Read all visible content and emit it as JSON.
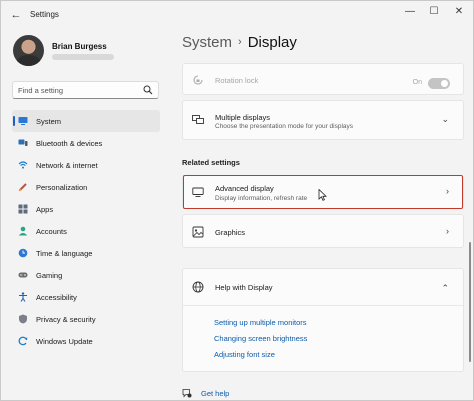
{
  "window": {
    "title": "Settings",
    "back_glyph": "←",
    "minimize_glyph": "—",
    "maximize_glyph": "☐",
    "close_glyph": "✕"
  },
  "profile": {
    "name": "Brian Burgess"
  },
  "search": {
    "placeholder": "Find a setting"
  },
  "sidebar": {
    "items": [
      {
        "label": "System",
        "icon": "system-icon",
        "active": true
      },
      {
        "label": "Bluetooth & devices",
        "icon": "bluetooth-icon"
      },
      {
        "label": "Network & internet",
        "icon": "network-icon"
      },
      {
        "label": "Personalization",
        "icon": "personalization-icon"
      },
      {
        "label": "Apps",
        "icon": "apps-icon"
      },
      {
        "label": "Accounts",
        "icon": "accounts-icon"
      },
      {
        "label": "Time & language",
        "icon": "time-language-icon"
      },
      {
        "label": "Gaming",
        "icon": "gaming-icon"
      },
      {
        "label": "Accessibility",
        "icon": "accessibility-icon"
      },
      {
        "label": "Privacy & security",
        "icon": "privacy-icon"
      },
      {
        "label": "Windows Update",
        "icon": "windows-update-icon"
      }
    ]
  },
  "breadcrumb": {
    "parent": "System",
    "separator": "›",
    "current": "Display"
  },
  "rotation_lock": {
    "title": "Rotation lock",
    "state_label": "On"
  },
  "multiple_displays": {
    "title": "Multiple displays",
    "subtitle": "Choose the presentation mode for your displays",
    "chevron": "⌄"
  },
  "related_settings": {
    "header": "Related settings",
    "advanced_display": {
      "title": "Advanced display",
      "subtitle": "Display information, refresh rate",
      "chevron": "›"
    },
    "graphics": {
      "title": "Graphics",
      "chevron": "›"
    }
  },
  "help": {
    "title": "Help with Display",
    "chevron": "⌃",
    "links": [
      "Setting up multiple monitors",
      "Changing screen brightness",
      "Adjusting font size"
    ]
  },
  "get_help": {
    "label": "Get help"
  },
  "colors": {
    "accent": "#1f5fbf",
    "link": "#0b5cad",
    "highlight_border": "#c0392b"
  }
}
